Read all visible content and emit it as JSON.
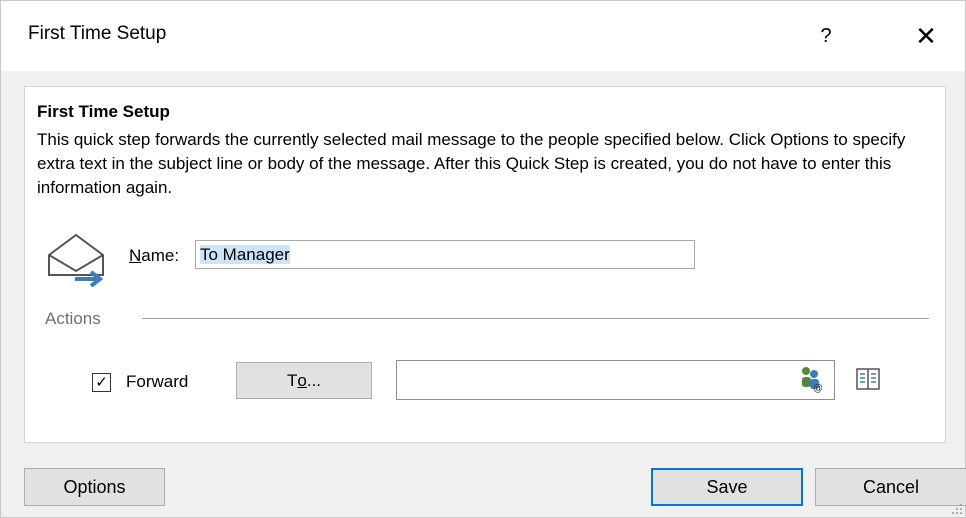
{
  "window": {
    "title": "First Time Setup",
    "help_glyph": "?",
    "close_glyph": "✕"
  },
  "content": {
    "heading": "First Time Setup",
    "description": "This quick step forwards the currently selected mail message to the people specified below. Click Options to specify extra text in the subject line or body of the message. After this Quick Step is created, you do not have to enter this information again.",
    "name_label_access": "N",
    "name_label_rest": "ame:",
    "name_value": "To Manager",
    "actions_label": "Actions"
  },
  "forward_action": {
    "checked": true,
    "check_glyph": "✓",
    "label": "Forward",
    "to_button_prefix": "T",
    "to_button_access": "o",
    "to_button_suffix": "...",
    "to_value": ""
  },
  "footer": {
    "options_label": "Options",
    "save_label": "Save",
    "cancel_label": "Cancel"
  },
  "icons": {
    "mail_forward": "envelope-forward-icon",
    "check_names": "check-names-icon",
    "address_book": "address-book-icon"
  },
  "colors": {
    "accent": "#0078d7",
    "selection": "#cce4f7",
    "arrow": "#3b7dbf"
  }
}
